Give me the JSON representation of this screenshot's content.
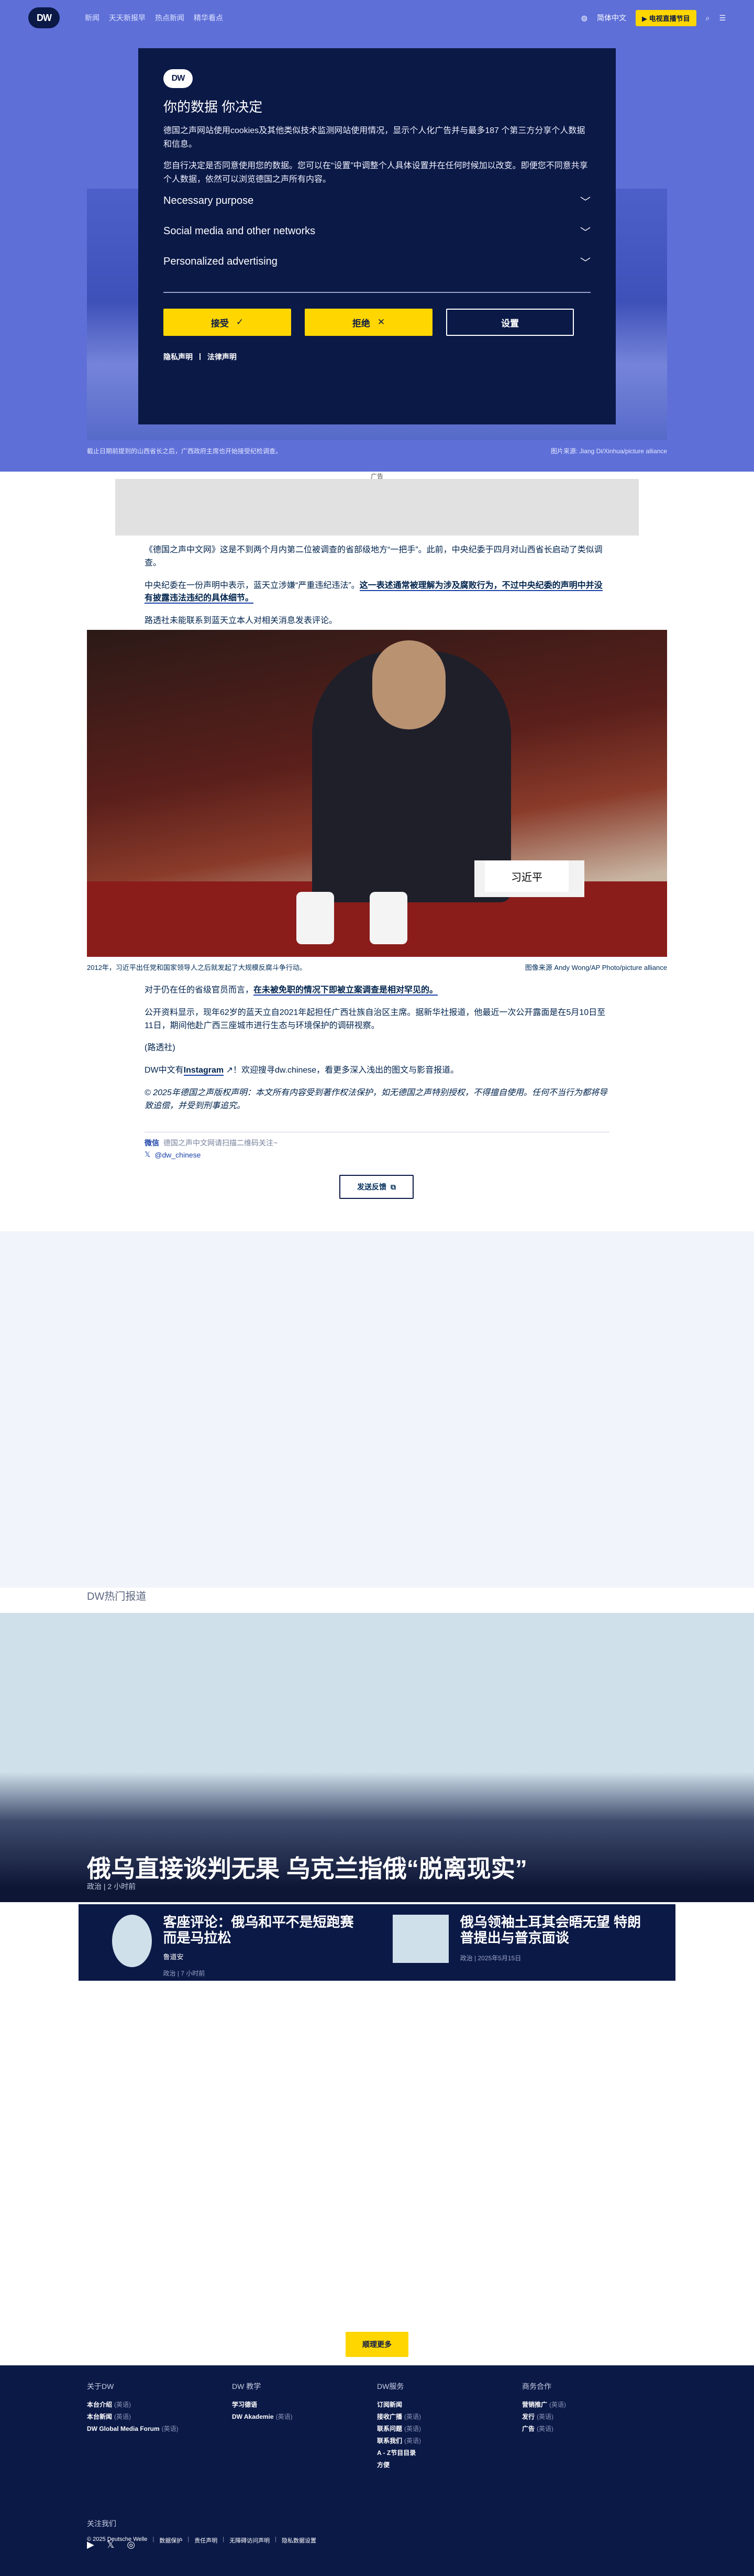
{
  "header": {
    "logo": "DW",
    "nav": [
      "新闻",
      "天天新报早",
      "热点新闻",
      "精华看点"
    ],
    "language_label": "简体中文",
    "live_button": "▶ 电视直播节目"
  },
  "consent": {
    "logo": "DW",
    "title": "你的数据 你决定",
    "para1": "德国之声网站使用cookies及其他类似技术监测网站使用情况，显示个人化广告并与最多187 个第三方分享个人数据和信息。",
    "para2": "您自行决定是否同意使用您的数据。您可以在“设置”中调整个人具体设置并在任何时候加以改变。即便您不同意共享个人数据，依然可以浏览德国之声所有内容。",
    "purposes": [
      "Necessary purpose",
      "Social media and other networks",
      "Personalized advertising"
    ],
    "accept": "接受",
    "reject": "拒绝",
    "settings": "设置",
    "privacy": "隐私声明",
    "legal": "法律声明"
  },
  "hero": {
    "caption": "截止日期前提到的山西省长之后，广西政府主席也开始接受纪检调查。",
    "credit": "图片来源: Jiang Di/Xinhua/picture alliance"
  },
  "ad_label": "广告",
  "article": {
    "p1": "《德国之声中文网》这是不到两个月内第二位被调查的省部级地方“一把手”。此前，中央纪委于四月对山西省长启动了类似调查。",
    "p2_plain": "中央纪委在一份声明中表示，蓝天立涉嫌“严重违纪违法”。",
    "p2_bold": "这一表述通常被理解为涉及腐败行为，不过中央纪委的声明中并没有披露违法违纪的具体细节。",
    "p3": "路透社未能联系到蓝天立本人对相关消息发表评论。",
    "p4_plain": "对于仍在任的省级官员而言，",
    "p4_bold": "在未被免职的情况下即被立案调查是相对罕见的。",
    "p5": "公开资料显示，现年62岁的蓝天立自2021年起担任广西壮族自治区主席。据新华社报道，他最近一次公开露面是在5月10日至11日，期间他赴广西三座城市进行生态与环境保护的调研视察。",
    "p6": "(路透社)",
    "p7_prefix": "DW中文有",
    "p7_link": "Instagram",
    "p7_suffix": "！欢迎搜寻dw.chinese，看更多深入浅出的图文与影音报道。",
    "p8": "© 2025年德国之声版权声明：本文所有内容受到著作权法保护，如无德国之声特别授权，不得擅自使用。任何不当行为都将导致追偿，并受到刑事追究。"
  },
  "photo": {
    "nameplate": "习近平",
    "caption": "2012年，习近平出任党和国家领导人之后就发起了大规模反腐斗争行动。",
    "credit": "图像来源 Andy Wong/AP Photo/picture alliance"
  },
  "meta": {
    "wechat_brand": "微信",
    "wechat_text": "德国之声中文网请扫描二维码关注~",
    "twitter_handle": "@dw_chinese"
  },
  "feedback": "发送反馈",
  "hot": {
    "label": "DW热门报道",
    "title": "俄乌直接谈判无果 乌克兰指俄“脱离现实”",
    "meta": "政治 | 2 小时前",
    "cards": [
      {
        "title": "客座评论：俄乌和平不是短跑赛 而是马拉松",
        "author": "鲁道安",
        "meta": "政治 | 7 小时前"
      },
      {
        "title": "俄乌领袖土耳其会晤无望 特朗普提出与普京面谈",
        "author": "",
        "meta": "政治 | 2025年5月15日"
      }
    ]
  },
  "more_button": "顺理更多",
  "footer": {
    "cols": [
      {
        "title": "关于DW",
        "items": [
          [
            "本台介绍",
            "(英语)"
          ],
          [
            "本台新闻",
            "(英语)"
          ],
          [
            "DW Global Media Forum",
            "(英语)"
          ]
        ]
      },
      {
        "title": "DW 教学",
        "items": [
          [
            "学习德语",
            ""
          ],
          [
            "DW Akademie",
            "(英语)"
          ]
        ]
      },
      {
        "title": "DW服务",
        "items": [
          [
            "订阅新闻",
            ""
          ],
          [
            "接收广播",
            "(英语)"
          ],
          [
            "联系问题",
            "(英语)"
          ],
          [
            "联系我们",
            "(英语)"
          ],
          [
            "A - Z节目目录",
            ""
          ],
          [
            "方便",
            ""
          ]
        ]
      },
      {
        "title": "商务合作",
        "items": [
          [
            "营销推广",
            "(英语)"
          ],
          [
            "发行",
            "(英语)"
          ],
          [
            "广告",
            "(英语)"
          ]
        ]
      }
    ],
    "follow": "关注我们",
    "legal": [
      "© 2025 Deutsche Welle",
      "数据保护",
      "责任声明",
      "无障碍访问声明",
      "隐私数据设置"
    ]
  }
}
